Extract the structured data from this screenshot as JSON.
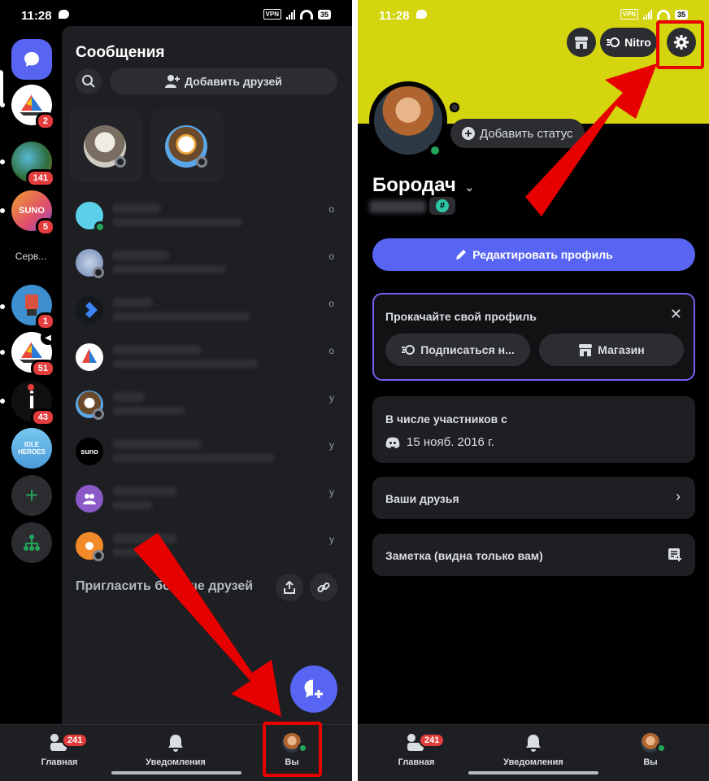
{
  "status_bar": {
    "time": "11:28",
    "vpn": "VPN",
    "battery": "35"
  },
  "left": {
    "panel_title": "Сообщения",
    "add_friends_label": "Добавить друзей",
    "rail": {
      "badges": [
        "2",
        "141",
        "5",
        "1",
        "51",
        "43"
      ],
      "suno_label": "SUNO",
      "servers_label": "Серв...",
      "idle_label": "IDLE HEROES"
    },
    "dm_times": [
      "о",
      "о",
      "о",
      "о",
      "у",
      "у",
      "у",
      "у"
    ],
    "suno_dm_label": "suno",
    "invite_text": "Пригласить больше друзей"
  },
  "nav": {
    "home_label": "Главная",
    "home_badge": "241",
    "notifications_label": "Уведомления",
    "you_label": "Вы"
  },
  "right": {
    "nitro_label": "Nitro",
    "add_status_label": "Добавить статус",
    "username": "Бородач",
    "edit_profile_label": "Редактировать профиль",
    "upgrade_title": "Прокачайте свой профиль",
    "subscribe_label": "Подписаться н...",
    "shop_label": "Магазин",
    "member_since_label": "В числе участников с",
    "member_since_date": "15 нояб. 2016 г.",
    "friends_label": "Ваши друзья",
    "note_label": "Заметка (видна только вам)"
  },
  "colors": {
    "accent": "#5865f2",
    "banner": "#d4d40f",
    "badge": "#e23c3c",
    "online": "#23a55a",
    "highlight": "#e60000"
  }
}
